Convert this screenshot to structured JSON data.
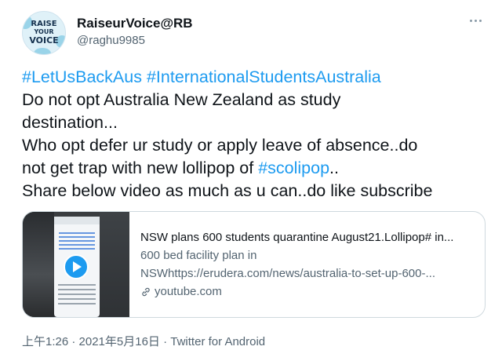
{
  "author": {
    "display_name": "RaiseurVoice@RB",
    "handle": "@raghu9985",
    "avatar_logo": {
      "line1": "RAISE",
      "line2": "YOUR",
      "line3": "VOICE"
    },
    "avatar_colors": {
      "bg": "#dff1f8",
      "text": "#16324f",
      "splash": "#7cc7e3"
    }
  },
  "more_icon": "more-horizontal-icon",
  "tweet": {
    "hashtags_line": [
      "#LetUsBackAus",
      "#InternationalStudentsAustralia"
    ],
    "line2": "Do not opt Australia New Zealand as study",
    "line3": "destination...",
    "line4": "Who opt defer ur study or apply leave of absence..do",
    "line5_prefix": "not get trap with new lollipop of ",
    "line5_hashtag": "#scolipop",
    "line5_suffix": "..",
    "line6": "Share below video as much as u can..do like subscribe"
  },
  "link_card": {
    "title": "NSW plans 600 students quarantine August21.Lollipop# in...",
    "description_line1": "600 bed facility plan in",
    "description_line2": "NSWhttps://erudera.com/news/australia-to-set-up-600-...",
    "domain": "youtube.com",
    "thumbnail": "video-thumbnail",
    "play_icon": "play-icon",
    "link_icon": "link-icon"
  },
  "meta": {
    "timestamp": "上午1:26 · 2021年5月16日",
    "separator": " · ",
    "source": "Twitter for Android"
  },
  "colors": {
    "accent": "#1d9bf0",
    "text_primary": "#0f1419",
    "text_secondary": "#536471",
    "border": "#cfd9de"
  }
}
